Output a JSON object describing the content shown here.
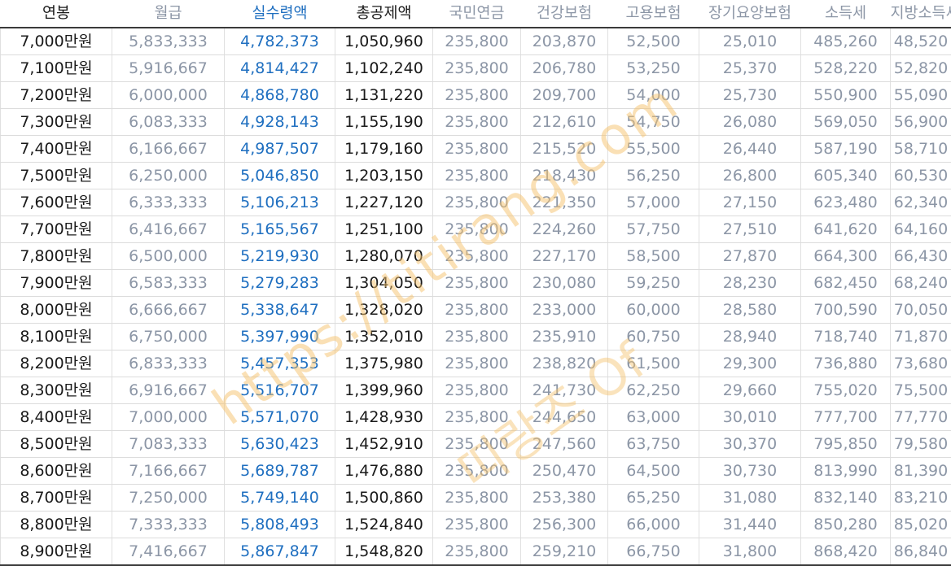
{
  "colors": {
    "dark": "#1a1a1a",
    "gray": "#8c96a6",
    "blue": "#1f6fc0",
    "watermark": "#f5c26b"
  },
  "headers": [
    "연봉",
    "월급",
    "실수령액",
    "총공제액",
    "국민연금",
    "건강보험",
    "고용보험",
    "장기요양보험",
    "소득세",
    "지방소득세"
  ],
  "rows": [
    [
      "7,000만원",
      "5,833,333",
      "4,782,373",
      "1,050,960",
      "235,800",
      "203,870",
      "52,500",
      "25,010",
      "485,260",
      "48,520"
    ],
    [
      "7,100만원",
      "5,916,667",
      "4,814,427",
      "1,102,240",
      "235,800",
      "206,780",
      "53,250",
      "25,370",
      "528,220",
      "52,820"
    ],
    [
      "7,200만원",
      "6,000,000",
      "4,868,780",
      "1,131,220",
      "235,800",
      "209,700",
      "54,000",
      "25,730",
      "550,900",
      "55,090"
    ],
    [
      "7,300만원",
      "6,083,333",
      "4,928,143",
      "1,155,190",
      "235,800",
      "212,610",
      "54,750",
      "26,080",
      "569,050",
      "56,900"
    ],
    [
      "7,400만원",
      "6,166,667",
      "4,987,507",
      "1,179,160",
      "235,800",
      "215,520",
      "55,500",
      "26,440",
      "587,190",
      "58,710"
    ],
    [
      "7,500만원",
      "6,250,000",
      "5,046,850",
      "1,203,150",
      "235,800",
      "218,430",
      "56,250",
      "26,800",
      "605,340",
      "60,530"
    ],
    [
      "7,600만원",
      "6,333,333",
      "5,106,213",
      "1,227,120",
      "235,800",
      "221,350",
      "57,000",
      "27,150",
      "623,480",
      "62,340"
    ],
    [
      "7,700만원",
      "6,416,667",
      "5,165,567",
      "1,251,100",
      "235,800",
      "224,260",
      "57,750",
      "27,510",
      "641,620",
      "64,160"
    ],
    [
      "7,800만원",
      "6,500,000",
      "5,219,930",
      "1,280,070",
      "235,800",
      "227,170",
      "58,500",
      "27,870",
      "664,300",
      "66,430"
    ],
    [
      "7,900만원",
      "6,583,333",
      "5,279,283",
      "1,304,050",
      "235,800",
      "230,080",
      "59,250",
      "28,230",
      "682,450",
      "68,240"
    ],
    [
      "8,000만원",
      "6,666,667",
      "5,338,647",
      "1,328,020",
      "235,800",
      "233,000",
      "60,000",
      "28,580",
      "700,590",
      "70,050"
    ],
    [
      "8,100만원",
      "6,750,000",
      "5,397,990",
      "1,352,010",
      "235,800",
      "235,910",
      "60,750",
      "28,940",
      "718,740",
      "71,870"
    ],
    [
      "8,200만원",
      "6,833,333",
      "5,457,353",
      "1,375,980",
      "235,800",
      "238,820",
      "61,500",
      "29,300",
      "736,880",
      "73,680"
    ],
    [
      "8,300만원",
      "6,916,667",
      "5,516,707",
      "1,399,960",
      "235,800",
      "241,730",
      "62,250",
      "29,660",
      "755,020",
      "75,500"
    ],
    [
      "8,400만원",
      "7,000,000",
      "5,571,070",
      "1,428,930",
      "235,800",
      "244,650",
      "63,000",
      "30,010",
      "777,700",
      "77,770"
    ],
    [
      "8,500만원",
      "7,083,333",
      "5,630,423",
      "1,452,910",
      "235,800",
      "247,560",
      "63,750",
      "30,370",
      "795,850",
      "79,580"
    ],
    [
      "8,600만원",
      "7,166,667",
      "5,689,787",
      "1,476,880",
      "235,800",
      "250,470",
      "64,500",
      "30,730",
      "813,990",
      "81,390"
    ],
    [
      "8,700만원",
      "7,250,000",
      "5,749,140",
      "1,500,860",
      "235,800",
      "253,380",
      "65,250",
      "31,080",
      "832,140",
      "83,210"
    ],
    [
      "8,800만원",
      "7,333,333",
      "5,808,493",
      "1,524,840",
      "235,800",
      "256,300",
      "66,000",
      "31,440",
      "850,280",
      "85,020"
    ],
    [
      "8,900만원",
      "7,416,667",
      "5,867,847",
      "1,548,820",
      "235,800",
      "259,210",
      "66,750",
      "31,800",
      "868,420",
      "86,840"
    ]
  ],
  "watermark": {
    "url_text": "https://titirang.com",
    "name_text": "띠랑즈 Of"
  }
}
